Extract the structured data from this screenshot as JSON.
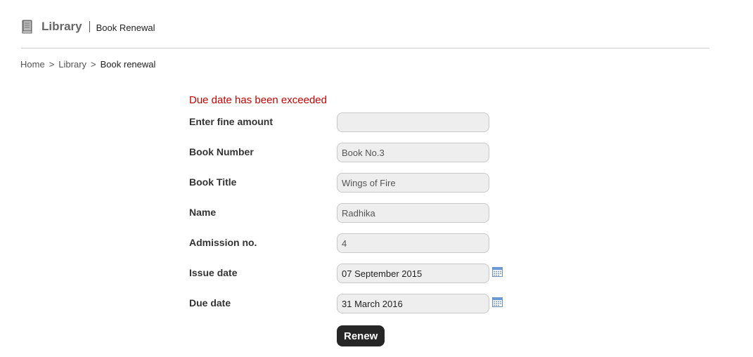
{
  "header": {
    "module_title": "Library",
    "page_title": "Book Renewal"
  },
  "breadcrumb": {
    "items": [
      "Home",
      "Library",
      "Book renewal"
    ],
    "separator": ">"
  },
  "form": {
    "error_message": "Due date has been exceeded",
    "fields": [
      {
        "label": "Enter fine amount",
        "value": ""
      },
      {
        "label": "Book Number",
        "value": "Book No.3"
      },
      {
        "label": "Book Title",
        "value": "Wings of Fire"
      },
      {
        "label": "Name",
        "value": "Radhika"
      },
      {
        "label": "Admission no.",
        "value": "4"
      },
      {
        "label": "Issue date",
        "value": "07 September 2015"
      },
      {
        "label": "Due date",
        "value": "31 March 2016"
      }
    ],
    "submit_label": "Renew"
  },
  "colors": {
    "error": "#cc0000",
    "button_bg": "#262626",
    "input_bg": "#eeeeee",
    "calendar_icon": "#5b8bc9"
  },
  "icons": {
    "header": "book-icon",
    "date_picker": "calendar-icon"
  }
}
